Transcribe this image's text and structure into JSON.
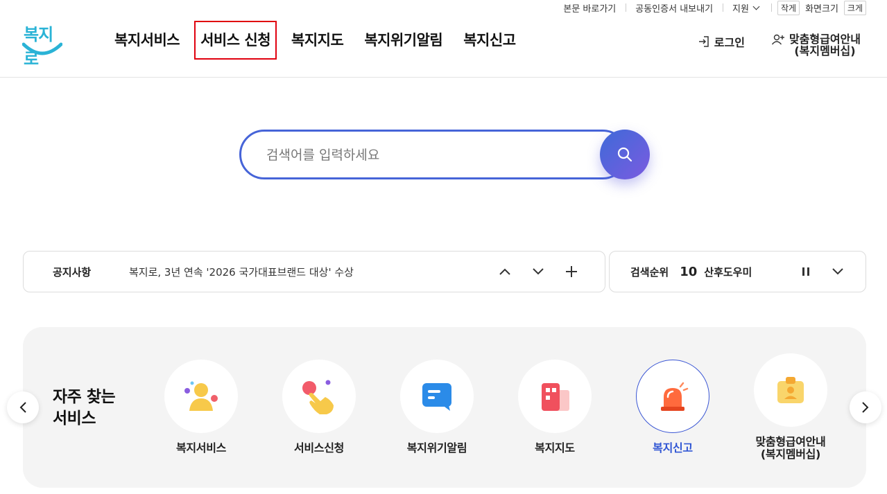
{
  "utility": {
    "skip_link": "본문 바로가기",
    "cert_export": "공동인증서 내보내기",
    "support": "지원",
    "zoom_small": "작게",
    "zoom_label": "화면크기",
    "zoom_large": "크게"
  },
  "logo": {
    "text": "복지로"
  },
  "gnb": [
    {
      "label": "복지서비스"
    },
    {
      "label": "서비스 신청"
    },
    {
      "label": "복지지도"
    },
    {
      "label": "복지위기알림"
    },
    {
      "label": "복지신고"
    }
  ],
  "header_right": {
    "login": "로그인",
    "member_line1": "맞춤형급여안내",
    "member_line2": "(복지멤버십)"
  },
  "search": {
    "placeholder": "검색어를 입력하세요"
  },
  "notice": {
    "title": "공지사항",
    "text": "복지로, 3년 연속 '2026 국가대표브랜드 대상' 수상"
  },
  "rank": {
    "title": "검색순위",
    "number": "10",
    "word": "산후도우미"
  },
  "frequent": {
    "title_line1": "자주 찾는",
    "title_line2": "서비스",
    "items": [
      {
        "label": "복지서비스",
        "icon": "person-icon"
      },
      {
        "label": "서비스신청",
        "icon": "hand-tap-icon"
      },
      {
        "label": "복지위기알림",
        "icon": "message-icon"
      },
      {
        "label": "복지지도",
        "icon": "map-building-icon"
      },
      {
        "label": "복지신고",
        "icon": "siren-icon",
        "active": true
      },
      {
        "label_line1": "맞춤형급여안내",
        "label_line2": "(복지멤버십)",
        "icon": "id-card-icon"
      }
    ]
  },
  "colors": {
    "brand_blue": "#4664d8",
    "highlight_red": "#e0000e",
    "active_blue": "#2f55d4",
    "logo_cyan": "#2ab3d6"
  }
}
